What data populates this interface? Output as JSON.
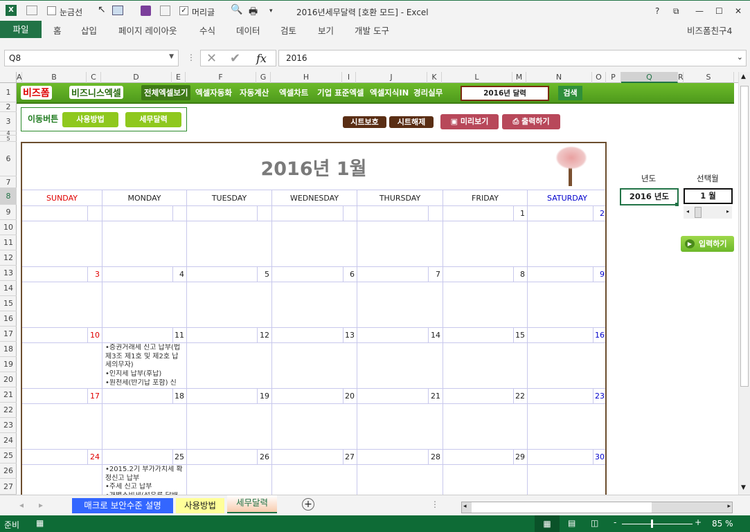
{
  "window": {
    "title": "2016년세무달력  [호환 모드] - Excel",
    "qat": {
      "gridlines_label": "눈금선",
      "gridlines_checked": false,
      "headings_label": "머리글",
      "headings_checked": true
    },
    "help": "?",
    "user": "비즈폼친구4"
  },
  "ribbon": {
    "tabs": [
      "파일",
      "홈",
      "삽입",
      "페이지 레이아웃",
      "수식",
      "데이터",
      "검토",
      "보기",
      "개발 도구"
    ],
    "active": "파일"
  },
  "formula_bar": {
    "name_box": "Q8",
    "value": "2016",
    "fx": "fx"
  },
  "columns": [
    "A",
    "B",
    "C",
    "D",
    "E",
    "F",
    "G",
    "H",
    "I",
    "J",
    "K",
    "L",
    "M",
    "N",
    "O",
    "P",
    "Q",
    "R",
    "S"
  ],
  "selected_column": "Q",
  "rows": [
    "1",
    "2",
    "3",
    "4",
    "5",
    "6",
    "7",
    "8",
    "9",
    "10",
    "11",
    "12",
    "13",
    "14",
    "15",
    "16",
    "17",
    "18",
    "19",
    "20",
    "21",
    "22",
    "23",
    "24",
    "25",
    "26",
    "27"
  ],
  "selected_row": "8",
  "banner": {
    "logo1": "비즈폼",
    "logo2": "비즈니스엑셀",
    "nav": [
      "전체엑셀보기",
      "엑셀자동화",
      "자동계산",
      "엑셀차트",
      "기업 표준엑셀",
      "엑셀지식IN",
      "경리실무"
    ],
    "search_value": "2016년 달력",
    "search_button": "검색"
  },
  "move_buttons": {
    "label": "이동버튼",
    "buttons": [
      "사용방법",
      "세무달력"
    ]
  },
  "actions": {
    "protect": "시트보호",
    "unprotect": "시트해제",
    "preview": "미리보기",
    "print": "출력하기"
  },
  "calendar": {
    "title": "2016년 1월",
    "weekdays": [
      "SUNDAY",
      "MONDAY",
      "TUESDAY",
      "WEDNESDAY",
      "THURSDAY",
      "FRIDAY",
      "SATURDAY"
    ],
    "colors": {
      "sunday": "#e00000",
      "saturday": "#0000cc",
      "weekday": "#222222",
      "border": "#6b4d2e",
      "grid": "#c8c8ec"
    },
    "weeks": [
      [
        null,
        null,
        null,
        null,
        null,
        1,
        2
      ],
      [
        3,
        4,
        5,
        6,
        7,
        8,
        9
      ],
      [
        10,
        11,
        12,
        13,
        14,
        15,
        16
      ],
      [
        17,
        18,
        19,
        20,
        21,
        22,
        23
      ],
      [
        24,
        25,
        26,
        27,
        28,
        29,
        30
      ]
    ],
    "events": {
      "11": [
        "•증권거래세 신고 납부(법 제3조 제1호 및 제2호 납세의무자)",
        "•인지세 납부(후납)",
        "•원천세(반기납 포함) 신"
      ],
      "25": [
        "•2015.2기 부가가치세 확정신고 납부",
        "•주세 신고 납부",
        "•개별소비세(석유류 담배"
      ]
    }
  },
  "side_panel": {
    "year_label": "년도",
    "year_value": "2016 년도",
    "month_label": "선택월",
    "month_value": "1 월",
    "month_slider": 0.0,
    "input_button": "입력하기"
  },
  "sheet_tabs": [
    {
      "label": "매크로 보안수준 설명",
      "color": "#3366ff"
    },
    {
      "label": "사용방법",
      "color": "#ffff99"
    },
    {
      "label": "세무달력",
      "color": "#f8cbad",
      "active": true
    }
  ],
  "status": {
    "ready": "준비",
    "zoom": "85 %"
  }
}
